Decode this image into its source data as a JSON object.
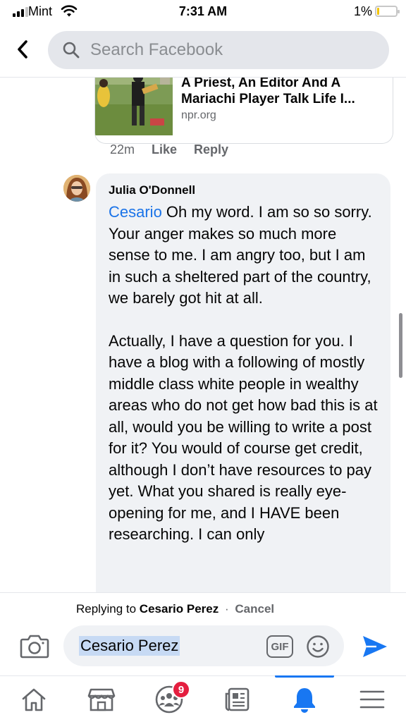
{
  "status_bar": {
    "carrier": "Mint",
    "time": "7:31 AM",
    "battery_percent": "1%",
    "battery_level": 0.01,
    "battery_color": "#f3c300"
  },
  "header": {
    "back_icon": "chevron-left-icon",
    "search_icon": "search-icon",
    "search_placeholder": "Search Facebook"
  },
  "link_preview": {
    "title": "A Priest, An Editor And A Mariachi Player Talk Life I...",
    "source": "npr.org"
  },
  "previous_comment_meta": {
    "time": "22m",
    "like_label": "Like",
    "reply_label": "Reply"
  },
  "comment": {
    "author": "Julia O'Donnell",
    "mention": "Cesario",
    "paragraph_1": " Oh my word. I am so so sorry. Your anger makes so much more sense to me. I am angry too, but I am in such a sheltered part of the country, we barely got hit at all.",
    "paragraph_2": "Actually, I have a question for you. I have a blog with a following of mostly middle class white people in wealthy areas who do not get how bad this is at all, would you be willing to write a post for it? You would of course get credit, although I don’t have resources to pay yet. What you shared is really eye-opening for me, and I HAVE been researching. I can only"
  },
  "reply": {
    "replying_prefix": "Replying to",
    "replying_to": "Cesario Perez",
    "separator": "·",
    "cancel_label": "Cancel",
    "composer_text": "Cesario Perez",
    "gif_label": "GIF"
  },
  "tabs": [
    {
      "name": "home",
      "icon": "home-icon"
    },
    {
      "name": "marketplace",
      "icon": "marketplace-icon"
    },
    {
      "name": "groups",
      "icon": "groups-icon",
      "badge": "9"
    },
    {
      "name": "news",
      "icon": "news-icon"
    },
    {
      "name": "notifications",
      "icon": "bell-icon",
      "active": true
    },
    {
      "name": "menu",
      "icon": "menu-icon"
    }
  ],
  "colors": {
    "accent": "#1877f2",
    "mention": "#1a73e8",
    "badge": "#e41e3f"
  }
}
